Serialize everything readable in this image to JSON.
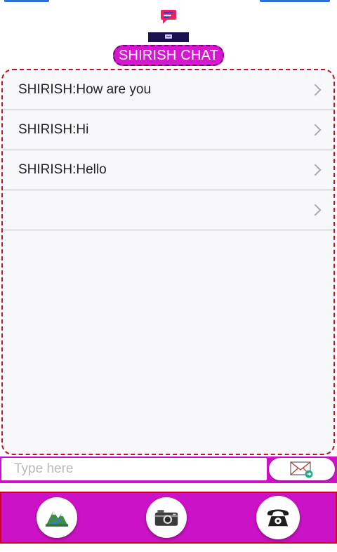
{
  "header": {
    "title": "SHIRISH CHAT",
    "logo_icon": "chat-logo-icon"
  },
  "messages": [
    {
      "text": "SHIRISH:How are you"
    },
    {
      "text": "SHIRISH:Hi"
    },
    {
      "text": "SHIRISH:Hello"
    },
    {
      "text": ""
    }
  ],
  "composer": {
    "placeholder": "Type here",
    "value": "",
    "send_icon": "envelope-send-icon"
  },
  "actions": {
    "gallery_icon": "gallery-icon",
    "camera_icon": "camera-icon",
    "phone_icon": "phone-icon"
  },
  "colors": {
    "accent": "#cc12c6",
    "border": "#c1121f",
    "dark_banner": "#1a1150"
  }
}
